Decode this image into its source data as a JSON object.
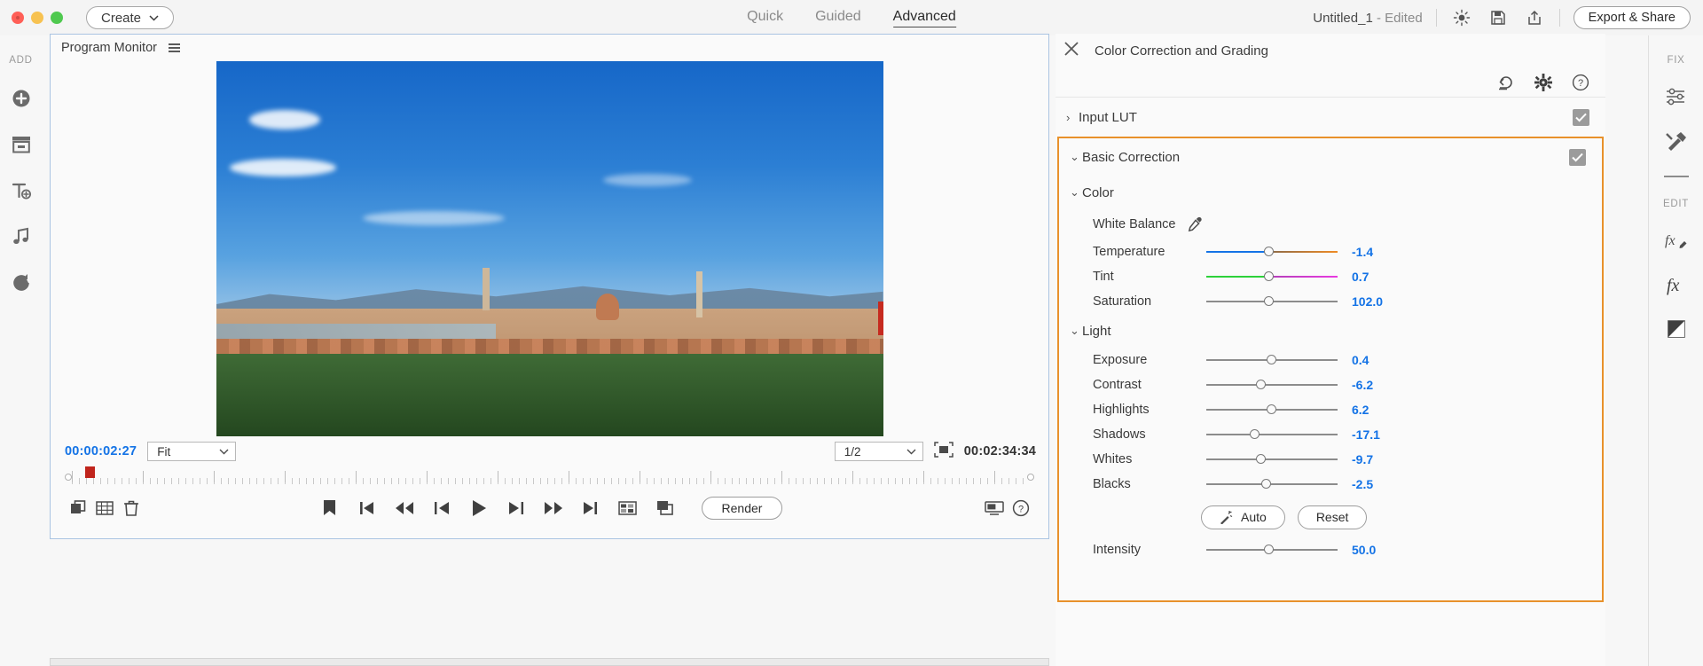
{
  "topbar": {
    "create_label": "Create",
    "modes": [
      {
        "label": "Quick",
        "active": false
      },
      {
        "label": "Guided",
        "active": false
      },
      {
        "label": "Advanced",
        "active": true
      }
    ],
    "doc_name": "Untitled_1",
    "doc_state": "- Edited",
    "icons": [
      "brightness-icon",
      "save-icon",
      "share-icon"
    ],
    "export_label": "Export & Share"
  },
  "left_rail": {
    "section_label": "ADD",
    "items": [
      {
        "icon": "add-media-plus-icon",
        "name": "add-media"
      },
      {
        "icon": "project-assets-icon",
        "name": "project-assets"
      },
      {
        "icon": "add-text-icon",
        "name": "add-text"
      },
      {
        "icon": "add-music-icon",
        "name": "add-music"
      },
      {
        "icon": "add-transitions-icon",
        "name": "add-transitions"
      }
    ]
  },
  "right_rail": {
    "fix_label": "FIX",
    "edit_label": "EDIT",
    "fix_items": [
      {
        "icon": "adjustments-sliders-icon",
        "name": "adjustments"
      },
      {
        "icon": "tools-hammer-icon",
        "name": "tools"
      }
    ],
    "edit_items": [
      {
        "icon": "fx-pencil-icon",
        "name": "effects-edit"
      },
      {
        "icon": "fx-icon",
        "name": "effects"
      },
      {
        "icon": "gradient-square-icon",
        "name": "color"
      }
    ]
  },
  "monitor": {
    "title": "Program Monitor",
    "menu_icon": "hamburger-menu-icon",
    "current_time": "00:00:02:27",
    "zoom_level": "Fit",
    "quality": "1/2",
    "duration": "00:02:34:34",
    "fit_icon": "fit-frame-icon",
    "transport": {
      "left_buttons": [
        {
          "icon": "duplicate-icon",
          "name": "copy-clip"
        },
        {
          "icon": "grid-icon",
          "name": "grid-view"
        },
        {
          "icon": "trash-icon",
          "name": "delete-clip"
        }
      ],
      "center_buttons": [
        {
          "icon": "marker-icon",
          "name": "add-marker"
        },
        {
          "icon": "skip-start-icon",
          "name": "go-to-start"
        },
        {
          "icon": "step-back-fast-icon",
          "name": "rewind"
        },
        {
          "icon": "step-back-frame-icon",
          "name": "step-back"
        },
        {
          "icon": "play-icon",
          "name": "play"
        },
        {
          "icon": "step-forward-frame-icon",
          "name": "step-forward"
        },
        {
          "icon": "step-forward-fast-icon",
          "name": "fast-forward"
        },
        {
          "icon": "skip-end-icon",
          "name": "go-to-end"
        },
        {
          "icon": "freeze-frame-icon",
          "name": "freeze-frame"
        },
        {
          "icon": "split-clip-icon",
          "name": "split-clip"
        }
      ],
      "render_label": "Render",
      "right_buttons": [
        {
          "icon": "display-icon",
          "name": "display-settings"
        },
        {
          "icon": "help-circle-icon",
          "name": "help"
        }
      ]
    }
  },
  "color_panel": {
    "close_icon": "close-icon",
    "title": "Color Correction and Grading",
    "tools": [
      {
        "icon": "undo-icon",
        "name": "reset-panel"
      },
      {
        "icon": "gear-icon",
        "name": "panel-settings"
      },
      {
        "icon": "help-circle-icon",
        "name": "panel-help"
      }
    ],
    "input_lut": {
      "label": "Input LUT",
      "expanded": false,
      "enabled": true
    },
    "basic_correction": {
      "label": "Basic Correction",
      "expanded": true,
      "enabled": true,
      "highlight_color": "#e8912b",
      "color_group": {
        "label": "Color",
        "white_balance_label": "White Balance",
        "pipette_icon": "eyedropper-icon",
        "sliders": [
          {
            "label": "Temperature",
            "value": "-1.4",
            "pos": 47,
            "track": "temp"
          },
          {
            "label": "Tint",
            "value": "0.7",
            "pos": 47,
            "track": "tint"
          },
          {
            "label": "Saturation",
            "value": "102.0",
            "pos": 47,
            "track": "plain"
          }
        ]
      },
      "light_group": {
        "label": "Light",
        "sliders": [
          {
            "label": "Exposure",
            "value": "0.4",
            "pos": 49,
            "track": "plain"
          },
          {
            "label": "Contrast",
            "value": "-6.2",
            "pos": 41,
            "track": "plain"
          },
          {
            "label": "Highlights",
            "value": "6.2",
            "pos": 49,
            "track": "plain"
          },
          {
            "label": "Shadows",
            "value": "-17.1",
            "pos": 36,
            "track": "plain"
          },
          {
            "label": "Whites",
            "value": "-9.7",
            "pos": 41,
            "track": "plain"
          },
          {
            "label": "Blacks",
            "value": "-2.5",
            "pos": 45,
            "track": "plain"
          }
        ]
      },
      "auto_label": "Auto",
      "auto_icon": "magic-wand-icon",
      "reset_label": "Reset",
      "intensity": {
        "label": "Intensity",
        "value": "50.0",
        "pos": 47
      }
    }
  }
}
